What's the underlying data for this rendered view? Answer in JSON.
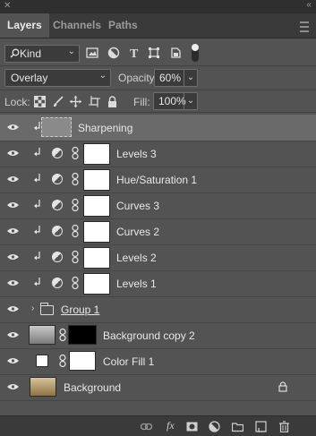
{
  "window": {
    "close_glyph": "✕",
    "collapse_glyph": "‹‹"
  },
  "tabs": [
    {
      "label": "Layers",
      "active": true
    },
    {
      "label": "Channels",
      "active": false
    },
    {
      "label": "Paths",
      "active": false
    }
  ],
  "filter": {
    "kind_label": "Kind",
    "icons": [
      "image-filter-icon",
      "adjustment-filter-icon",
      "type-filter-icon",
      "shape-filter-icon",
      "smart-object-filter-icon"
    ]
  },
  "blend": {
    "mode": "Overlay",
    "opacity_label": "Opacity:",
    "opacity_value": "60%",
    "fill_label": "Fill:",
    "fill_value": "100%"
  },
  "lock": {
    "label": "Lock:",
    "icons": [
      "lock-transparent-pixels-icon",
      "lock-image-pixels-icon",
      "lock-position-icon",
      "lock-artboard-icon",
      "lock-all-icon"
    ]
  },
  "layers": [
    {
      "name": "Sharpening",
      "type": "pixel-clipped",
      "selected": true
    },
    {
      "name": "Levels 3",
      "type": "adjustment"
    },
    {
      "name": "Hue/Saturation 1",
      "type": "adjustment"
    },
    {
      "name": "Curves 3",
      "type": "adjustment"
    },
    {
      "name": "Curves 2",
      "type": "adjustment"
    },
    {
      "name": "Levels 2",
      "type": "adjustment"
    },
    {
      "name": "Levels 1",
      "type": "adjustment"
    },
    {
      "name": "Group 1",
      "type": "group"
    },
    {
      "name": "Background copy 2",
      "type": "pixel-with-mask"
    },
    {
      "name": "Color Fill 1",
      "type": "fill"
    },
    {
      "name": "Background",
      "type": "background-locked"
    }
  ],
  "bottom_icons": [
    "link-layers-icon",
    "fx-icon",
    "add-mask-icon",
    "new-adjustment-icon",
    "new-group-icon",
    "new-layer-icon",
    "delete-icon"
  ],
  "bottom_fx_label": "fx"
}
